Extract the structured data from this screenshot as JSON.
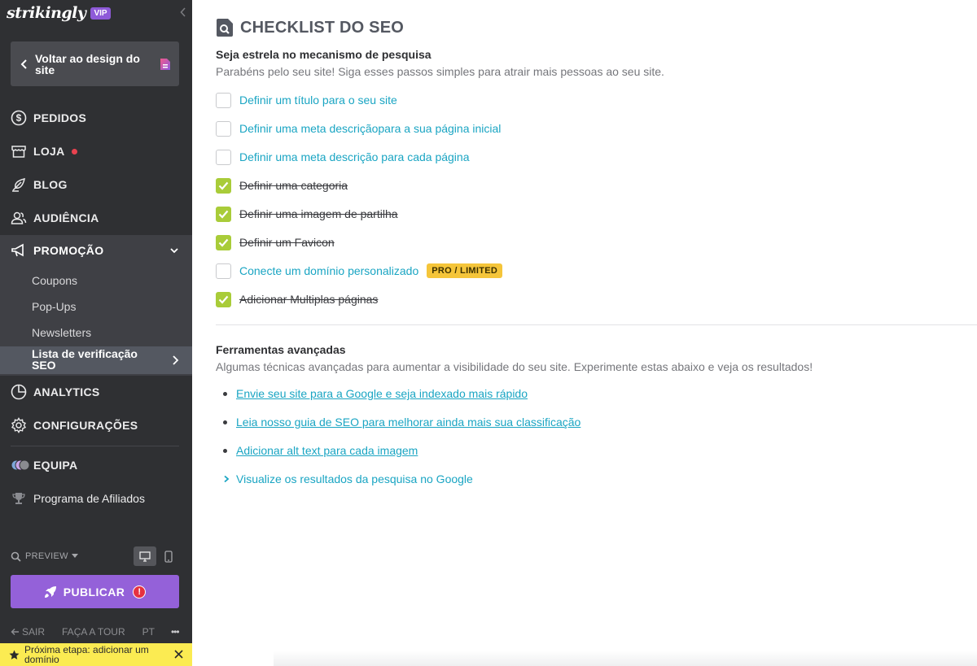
{
  "brand": {
    "logo_text": "strikingly",
    "vip_label": "VIP"
  },
  "sidebar": {
    "back_button_label": "Voltar ao design do site",
    "nav": [
      {
        "key": "pedidos",
        "label": "PEDIDOS",
        "icon": "dollar-circle-icon"
      },
      {
        "key": "loja",
        "label": "LOJA",
        "icon": "store-icon",
        "badge": "red-dot"
      },
      {
        "key": "blog",
        "label": "BLOG",
        "icon": "feather-pen-icon"
      },
      {
        "key": "audiencia",
        "label": "AUDIÊNCIA",
        "icon": "users-icon"
      },
      {
        "key": "promocao",
        "label": "PROMOÇÃO",
        "icon": "megaphone-icon",
        "expanded": true
      },
      {
        "key": "analytics",
        "label": "ANALYTICS",
        "icon": "pie-chart-icon"
      },
      {
        "key": "configuracoes",
        "label": "CONFIGURAÇÕES",
        "icon": "gear-icon"
      },
      {
        "key": "equipa",
        "label": "EQUIPA",
        "icon": "team-avatars-icon"
      },
      {
        "key": "afiliados",
        "label": "Programa de Afiliados",
        "icon": "trophy-icon"
      }
    ],
    "promo_subitems": [
      "Coupons",
      "Pop-Ups",
      "Newsletters"
    ],
    "active_subitem": "Lista de verificação SEO",
    "preview_label": "PREVIEW",
    "publish_label": "PUBLICAR",
    "publish_alert": "!",
    "footer": {
      "exit": "SAIR",
      "tour": "FAÇA A TOUR",
      "lang": "PT",
      "more": "•••"
    },
    "next_step": "Próxima etapa: adicionar um domínio"
  },
  "main": {
    "title": "CHECKLIST DO SEO",
    "section1": {
      "heading": "Seja estrela no mecanismo de pesquisa",
      "description": "Parabéns pelo seu site! Siga esses passos simples para atrair mais pessoas ao seu site.",
      "items": [
        {
          "label": "Definir um título para o seu site",
          "checked": false
        },
        {
          "label": "Definir uma meta descriçãopara a sua página inicial",
          "checked": false
        },
        {
          "label": "Definir uma meta descrição para cada página",
          "checked": false
        },
        {
          "label": "Definir uma categoria",
          "checked": true
        },
        {
          "label": "Definir uma imagem de partilha",
          "checked": true
        },
        {
          "label": "Definir um Favicon",
          "checked": true
        },
        {
          "label": "Conecte um domínio personalizado",
          "checked": false,
          "badge": "PRO / LIMITED"
        },
        {
          "label": "Adicionar Multiplas páginas",
          "checked": true
        }
      ]
    },
    "section2": {
      "heading": "Ferramentas avançadas",
      "description": "Algumas técnicas avançadas para aumentar a visibilidade do seu site. Experimente estas abaixo e veja os resultados!",
      "links": [
        "Envie seu site para a Google e seja indexado mais rápido",
        "Leia nosso guia de SEO para melhorar ainda mais sua classificação",
        "Adicionar alt text para cada imagem"
      ],
      "expand_label": "Visualize os resultados da pesquisa no Google"
    }
  },
  "colors": {
    "sidebar_bg": "#2f3033",
    "accent_link": "#1aa5c3",
    "checked_green": "#a9cc39",
    "publish_purple": "#9461d9",
    "pro_badge": "#f5c53a",
    "next_step_bg": "#fbeb52"
  }
}
